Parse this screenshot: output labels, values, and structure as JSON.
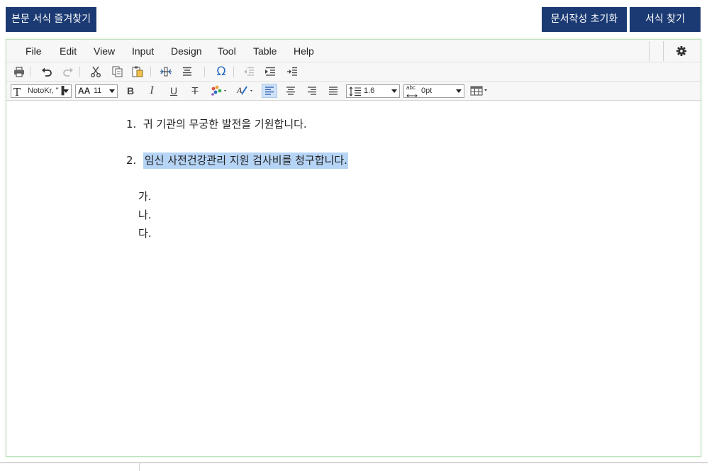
{
  "top_buttons": {
    "favorites": "본문 서식 즐겨찾기",
    "reset": "문서작성 초기화",
    "find": "서식 찾기"
  },
  "menu": {
    "file": "File",
    "edit": "Edit",
    "view": "View",
    "input": "Input",
    "design": "Design",
    "tool": "Tool",
    "table": "Table",
    "help": "Help"
  },
  "toolbar": {
    "font_family": "NotoKr, \"▐",
    "font_size": "11",
    "line_height": "1.6",
    "letter_spacing": "0pt",
    "font_size_icon_text": "AA",
    "letter_spacing_icon_text": "abc",
    "bold": "B",
    "italic": "I",
    "underline": "U",
    "strike": "T",
    "omega": "Ω"
  },
  "document": {
    "item1_num": "1.",
    "item1_text": "귀 기관의 무궁한 발전을 기원합니다.",
    "item2_num": "2.",
    "item2_text": "임신 사전건강관리 지원 검사비를 청구합니다.",
    "sub_a": "가.",
    "sub_b": "나.",
    "sub_c": "다."
  },
  "colors": {
    "button_bg": "#1b3a73",
    "selection": "#b6d4f5",
    "editor_border": "#bfe0bc"
  }
}
